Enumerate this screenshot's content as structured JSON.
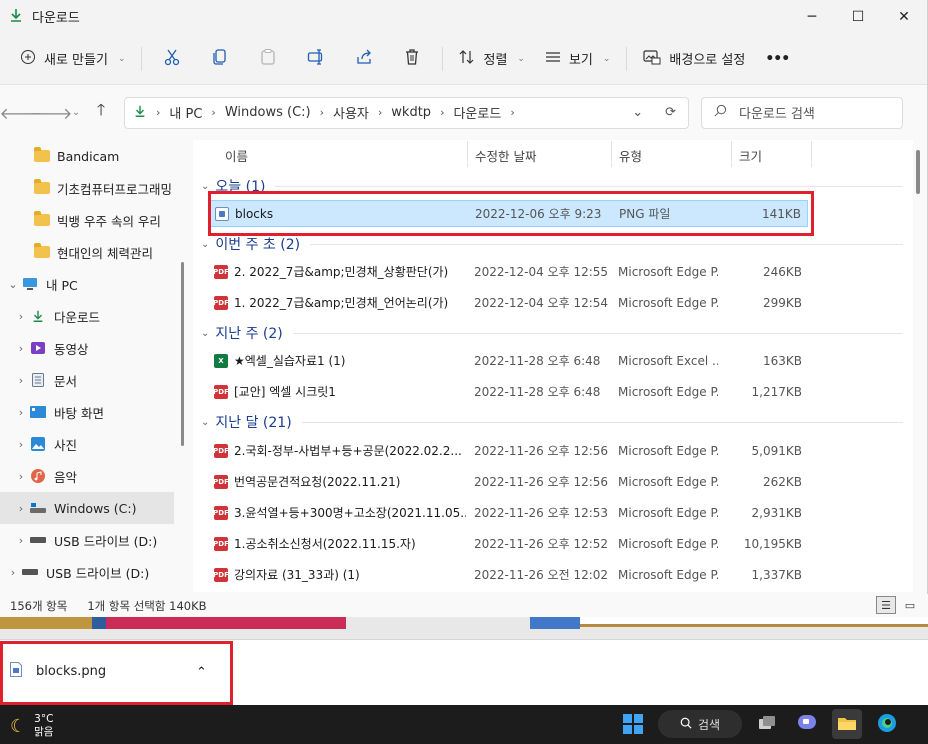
{
  "window": {
    "title": "다운로드",
    "controls": [
      "─",
      "☐",
      "✕"
    ]
  },
  "toolbar": {
    "new_label": "새로 만들기",
    "sort_label": "정렬",
    "view_label": "보기",
    "background_label": "배경으로 설정",
    "more_label": "•••"
  },
  "address": {
    "crumbs": [
      "내 PC",
      "Windows (C:)",
      "사용자",
      "wkdtp",
      "다운로드"
    ],
    "search_placeholder": "다운로드 검색"
  },
  "sidebar": {
    "folders": [
      "Bandicam",
      "기초컴퓨터프로그래밍",
      "빅뱅 우주 속의 우리",
      "현대인의 체력관리"
    ],
    "this_pc": "내 PC",
    "items": [
      {
        "label": "다운로드",
        "icon": "download-icon"
      },
      {
        "label": "동영상",
        "icon": "video-icon"
      },
      {
        "label": "문서",
        "icon": "document-icon"
      },
      {
        "label": "바탕 화면",
        "icon": "desktop-icon"
      },
      {
        "label": "사진",
        "icon": "picture-icon"
      },
      {
        "label": "음악",
        "icon": "music-icon"
      },
      {
        "label": "Windows (C:)",
        "icon": "drive-icon"
      },
      {
        "label": "USB 드라이브 (D:)",
        "icon": "usb-drive-icon"
      },
      {
        "label": "USB 드라이브 (D:)",
        "icon": "usb-drive-icon"
      }
    ]
  },
  "columns": {
    "name": "이름",
    "date": "수정한 날짜",
    "type": "유형",
    "size": "크기"
  },
  "groups": [
    {
      "label": "오늘 (1)",
      "files": [
        {
          "name": "blocks",
          "date": "2022-12-06 오후 9:23",
          "type": "PNG 파일",
          "size": "141KB",
          "kind": "png",
          "selected": true
        }
      ]
    },
    {
      "label": "이번 주 초 (2)",
      "files": [
        {
          "name": "2. 2022_7급&amp;민경채_상황판단(가)",
          "date": "2022-12-04 오후 12:55",
          "type": "Microsoft Edge P...",
          "size": "246KB",
          "kind": "pdf"
        },
        {
          "name": "1. 2022_7급&amp;민경채_언어논리(가)",
          "date": "2022-12-04 오후 12:54",
          "type": "Microsoft Edge P...",
          "size": "299KB",
          "kind": "pdf"
        }
      ]
    },
    {
      "label": "지난 주 (2)",
      "files": [
        {
          "name": "★엑셀_실습자료1 (1)",
          "date": "2022-11-28 오후 6:48",
          "type": "Microsoft Excel ...",
          "size": "163KB",
          "kind": "xls"
        },
        {
          "name": "[교안] 엑셀 시크릿1",
          "date": "2022-11-28 오후 6:48",
          "type": "Microsoft Edge P...",
          "size": "1,217KB",
          "kind": "pdf"
        }
      ]
    },
    {
      "label": "지난 달 (21)",
      "files": [
        {
          "name": "2.국회-정부-사법부+등+공문(2022.02.2...",
          "date": "2022-11-26 오후 12:56",
          "type": "Microsoft Edge P...",
          "size": "5,091KB",
          "kind": "pdf"
        },
        {
          "name": "번역공문견적요청(2022.11.21)",
          "date": "2022-11-26 오후 12:56",
          "type": "Microsoft Edge P...",
          "size": "262KB",
          "kind": "pdf"
        },
        {
          "name": "3.윤석열+등+300명+고소장(2021.11.05...",
          "date": "2022-11-26 오후 12:53",
          "type": "Microsoft Edge P...",
          "size": "2,931KB",
          "kind": "pdf"
        },
        {
          "name": "1.공소취소신청서(2022.11.15.자)",
          "date": "2022-11-26 오후 12:52",
          "type": "Microsoft Edge P...",
          "size": "10,195KB",
          "kind": "pdf"
        },
        {
          "name": "강의자료 (31_33과) (1)",
          "date": "2022-11-26 오전 12:02",
          "type": "Microsoft Edge P...",
          "size": "1,337KB",
          "kind": "pdf"
        }
      ]
    }
  ],
  "status": {
    "count": "156개 항목",
    "selection": "1개 항목 선택함 140KB"
  },
  "download_bar": {
    "filename": "blocks.png"
  },
  "taskbar": {
    "temp": "3°C",
    "condition": "맑음",
    "search_label": "검색"
  },
  "colors": {
    "accent": "#0067c0",
    "highlight": "#e0202c",
    "selection": "#cce8ff"
  }
}
